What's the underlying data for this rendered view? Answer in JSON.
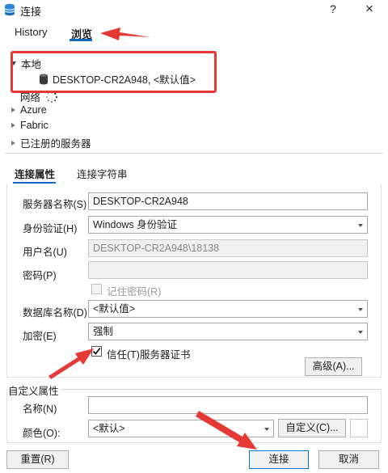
{
  "window": {
    "title": "连接",
    "help_icon": "?",
    "close_icon": "×"
  },
  "top_tabs": [
    {
      "label": "History"
    },
    {
      "label": "浏览"
    }
  ],
  "tree": {
    "local_label": "本地",
    "local_server": "DESKTOP-CR2A948, <默认值>",
    "network_label": "网络",
    "azure_label": "Azure",
    "fabric_label": "Fabric",
    "registered_label": "已注册的服务器"
  },
  "inner_tabs": [
    {
      "label": "连接属性"
    },
    {
      "label": "连接字符串"
    }
  ],
  "form": {
    "server_name_label": "服务器名称(S)",
    "server_name_value": "DESKTOP-CR2A948",
    "auth_label": "身份验证(H)",
    "auth_value": "Windows 身份验证",
    "username_label": "用户名(U)",
    "username_value": "DESKTOP-CR2A948\\18138",
    "password_label": "密码(P)",
    "password_value": "",
    "remember_password_label": "记住密码(R)",
    "database_label": "数据库名称(D)",
    "database_value": "<默认值>",
    "encrypt_label": "加密(E)",
    "encrypt_value": "强制",
    "trust_cert_label": "信任(T)服务器证书",
    "trust_cert_checked": true,
    "advanced_button": "高级(A)..."
  },
  "custom": {
    "group_label": "自定义属性",
    "name_label": "名称(N)",
    "name_value": "",
    "color_label": "颜色(O):",
    "color_value": "<默认>",
    "custom_button": "自定义(C)..."
  },
  "footer": {
    "reset_button": "重置(R)",
    "connect_button": "连接",
    "cancel_button": "取消"
  },
  "colors": {
    "accent": "#0f6cbd",
    "annotation": "#e53935"
  }
}
